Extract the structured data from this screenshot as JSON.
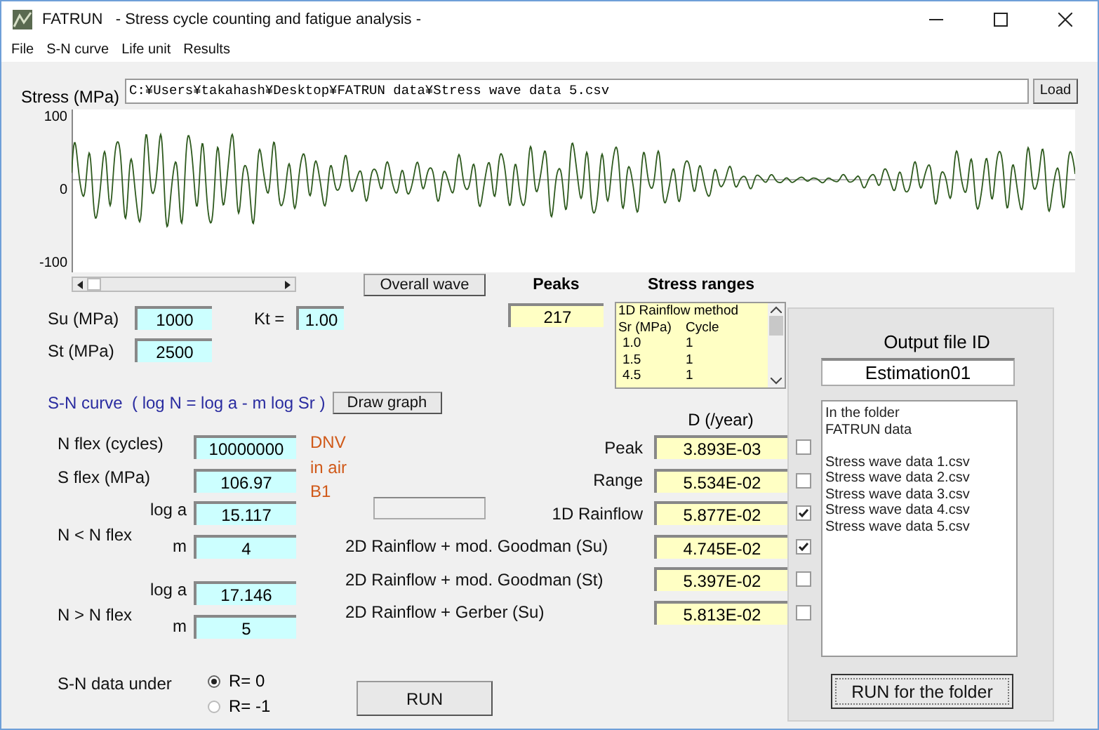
{
  "window": {
    "title": "FATRUN   - Stress cycle counting and fatigue analysis -"
  },
  "menu": [
    "File",
    "S-N curve",
    "Life unit",
    "Results"
  ],
  "file": {
    "label": "Stress (MPa)",
    "path": "C:¥Users¥takahash¥Desktop¥FATRUN data¥Stress wave data 5.csv",
    "button": "Load"
  },
  "wave_plot": {
    "y_ticks": [
      "100",
      "0",
      "-100"
    ]
  },
  "overall_button": "Overall wave",
  "material": {
    "su": {
      "label": "Su (MPa)",
      "value": "1000"
    },
    "st": {
      "label": "St (MPa)",
      "value": "2500"
    },
    "kt": {
      "label": "Kt =",
      "value": "1.00"
    }
  },
  "sn_curve": {
    "heading": "S-N curve  ( log N = log a - m log Sr )",
    "button": "Draw graph",
    "n_flex": {
      "label": "N flex (cycles)",
      "value": "10000000"
    },
    "s_flex": {
      "label": "S flex (MPa)",
      "value": "106.97"
    },
    "standard": [
      "DNV",
      "in air",
      "B1"
    ],
    "ranges": [
      {
        "label": "N < N flex",
        "log_a_label": "log a",
        "log_a": "15.117",
        "m_label": "m",
        "m": "4"
      },
      {
        "label": "N > N flex",
        "log_a_label": "log a",
        "log_a": "17.146",
        "m_label": "m",
        "m": "5"
      }
    ],
    "data_under": {
      "label": "S-N data under",
      "options": [
        {
          "label": "R= 0",
          "selected": true
        },
        {
          "label": "R= -1",
          "selected": false
        }
      ]
    }
  },
  "peaks": {
    "heading": "Peaks",
    "value": "217"
  },
  "stress_ranges": {
    "heading": "Stress ranges",
    "method": "1D Rainflow method",
    "header": [
      "Sr (MPa)",
      "Cycle"
    ],
    "rows": [
      [
        "1.0",
        "1"
      ],
      [
        "1.5",
        "1"
      ],
      [
        "4.5",
        "1"
      ]
    ]
  },
  "damage": {
    "heading": "D (/year)",
    "rows": [
      {
        "label": "Peak",
        "value": "3.893E-03",
        "checked": false,
        "kind": "short"
      },
      {
        "label": "Range",
        "value": "5.534E-02",
        "checked": false,
        "kind": "short"
      },
      {
        "label": "1D Rainflow",
        "value": "5.877E-02",
        "checked": true,
        "kind": "short"
      },
      {
        "label": "2D Rainflow + mod. Goodman (Su)",
        "value": "4.745E-02",
        "checked": true,
        "kind": "long"
      },
      {
        "label": "2D Rainflow + mod. Goodman (St)",
        "value": "5.397E-02",
        "checked": false,
        "kind": "long"
      },
      {
        "label": "2D Rainflow + Gerber (Su)",
        "value": "5.813E-02",
        "checked": false,
        "kind": "long"
      }
    ]
  },
  "run_button": "RUN",
  "folder": {
    "heading": "Output file ID",
    "output_id": "Estimation01",
    "caption": [
      "In the folder",
      "FATRUN data"
    ],
    "files": [
      "Stress wave data 1.csv",
      "Stress wave data 2.csv",
      "Stress wave data 3.csv",
      "Stress wave data 4.csv",
      "Stress wave data 5.csv"
    ],
    "button": "RUN for the folder"
  }
}
